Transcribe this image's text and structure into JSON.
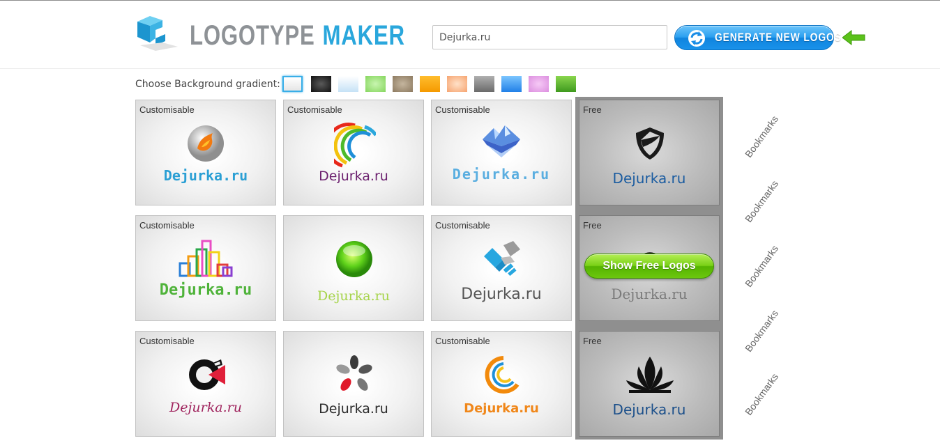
{
  "header": {
    "logo_word1": "LOGOTYPE",
    "logo_word2": "MAKER",
    "search_value": "Dejurka.ru",
    "generate_label": "Generate New Logos"
  },
  "background": {
    "label": "Choose Background gradient:",
    "swatches": [
      "#f6f6f6",
      "#262626",
      "#dbeefb",
      "#9ee27f",
      "#a2927b",
      "#fba518",
      "#f9b78b",
      "#8a8a8a",
      "#3a9ef0",
      "#e7a2e9",
      "#5fb633"
    ],
    "selected_index": 0
  },
  "cards": [
    {
      "tag": "Customisable",
      "name": "Dejurka.ru",
      "icon": "phoenix-ball-icon",
      "name_color": "#2a9fd4"
    },
    {
      "tag": "Customisable",
      "name": "Dejurka.ru",
      "icon": "rainbow-arc-icon",
      "name_color": "#6b1f6e"
    },
    {
      "tag": "Customisable",
      "name": "Dejurka.ru",
      "icon": "crystal-mountain-icon",
      "name_color": "#5aaee0"
    },
    {
      "tag": "Free",
      "name": "Dejurka.ru",
      "icon": "shield-emblem-icon",
      "name_color": "#1b5ca0"
    },
    {
      "tag": "Customisable",
      "name": "Dejurka.ru",
      "icon": "colored-bars-icon",
      "name_color": "#4fb33a"
    },
    {
      "tag": "",
      "name": "Dejurka.ru",
      "icon": "green-orb-icon",
      "name_color": "#a6d44a"
    },
    {
      "tag": "Customisable",
      "name": "Dejurka.ru",
      "icon": "handshake-icon",
      "name_color": "#555555"
    },
    {
      "tag": "Free",
      "name": "Dejurka.ru",
      "icon": "dark-sphere-icon",
      "name_color": "#7a7a7a"
    },
    {
      "tag": "Customisable",
      "name": "Dejurka.ru",
      "icon": "circle-c-icon",
      "name_color": "#a0245e"
    },
    {
      "tag": "",
      "name": "Dejurka.ru",
      "icon": "petal-flower-icon",
      "name_color": "#2b2b2b"
    },
    {
      "tag": "Customisable",
      "name": "Dejurka.ru",
      "icon": "orange-rings-icon",
      "name_color": "#f0871a"
    },
    {
      "tag": "Free",
      "name": "Dejurka.ru",
      "icon": "lotus-flame-icon",
      "name_color": "#1b4f8a"
    }
  ],
  "show_free_label": "Show Free Logos",
  "bookmarks": [
    "Bookmarks",
    "Bookmarks",
    "Bookmarks",
    "Bookmarks",
    "Bookmarks"
  ]
}
